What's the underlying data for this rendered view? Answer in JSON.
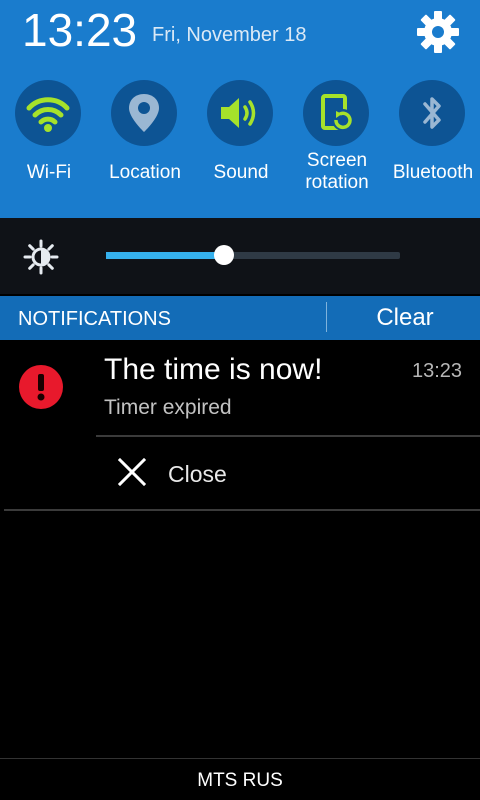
{
  "status": {
    "time": "13:23",
    "date": "Fri, November 18"
  },
  "quick_settings": [
    {
      "label": "Wi-Fi",
      "icon": "wifi-icon",
      "active": true
    },
    {
      "label": "Location",
      "icon": "location-icon",
      "active": false
    },
    {
      "label": "Sound",
      "icon": "sound-icon",
      "active": true
    },
    {
      "label": "Screen\nrotation",
      "icon": "screen-rotation-icon",
      "active": true
    },
    {
      "label": "Bluetooth",
      "icon": "bluetooth-icon",
      "active": false
    }
  ],
  "brightness": {
    "level": 0.4,
    "auto": true
  },
  "notifications_header": {
    "title": "NOTIFICATIONS",
    "clear_label": "Clear"
  },
  "notification": {
    "title": "The time is now!",
    "time": "13:23",
    "subtitle": "Timer expired",
    "action_label": "Close",
    "icon": "alert-icon"
  },
  "carrier": "MTS RUS",
  "colors": {
    "panel_blue": "#1a7ccd",
    "tile_circle": "#0d5494",
    "active_green": "#a6e22b",
    "inactive_icon": "#9ab7d3",
    "slider_fill": "#35b0ec",
    "alert_red": "#e8192c"
  }
}
